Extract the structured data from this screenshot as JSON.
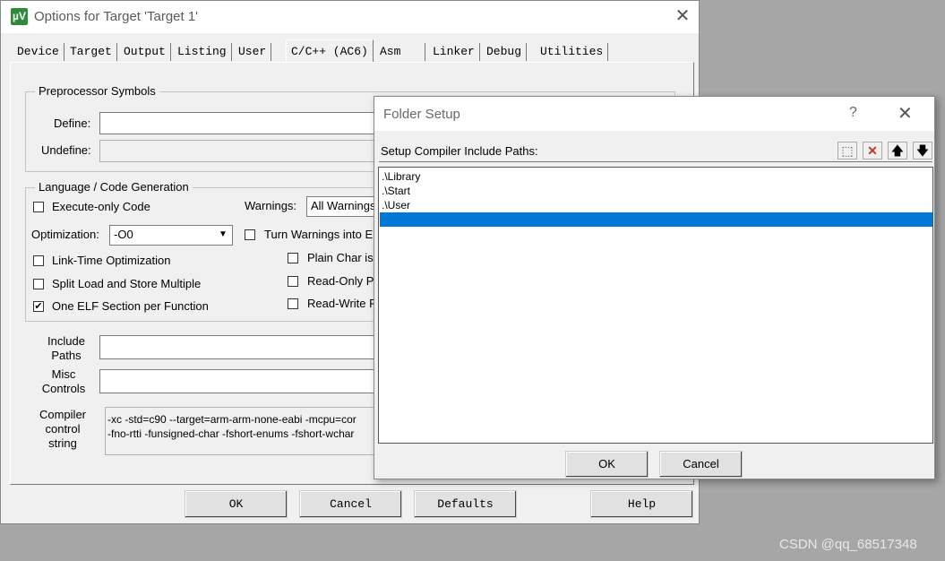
{
  "options_dialog": {
    "title": "Options for Target 'Target 1'",
    "app_icon": "µV",
    "tabs": [
      "Device",
      "Target",
      "Output",
      "Listing",
      "User",
      "C/C++ (AC6)",
      "Asm",
      "Linker",
      "Debug",
      "Utilities"
    ],
    "active_tab": "C/C++ (AC6)",
    "preprocessor": {
      "title": "Preprocessor Symbols",
      "define_label": "Define:",
      "define_value": "",
      "undefine_label": "Undefine:",
      "undefine_value": ""
    },
    "language": {
      "title": "Language / Code Generation",
      "execute_only": "Execute-only Code",
      "warnings_label": "Warnings:",
      "warnings_value": "All Warnings",
      "optimization_label": "Optimization:",
      "optimization_value": "-O0",
      "turn_warnings": "Turn Warnings into E",
      "link_time": "Link-Time Optimization",
      "plain_char": "Plain Char is",
      "split_load": "Split Load and Store Multiple",
      "read_only": "Read-Only P",
      "one_elf": "One ELF Section per Function",
      "read_write": "Read-Write F",
      "checked": "✔"
    },
    "include_paths_label": [
      "Include",
      "Paths"
    ],
    "misc_controls_label": [
      "Misc",
      "Controls"
    ],
    "compiler_string_label": [
      "Compiler",
      "control",
      "string"
    ],
    "compiler_string": [
      "-xc -std=c90 --target=arm-arm-none-eabi -mcpu=cor",
      "-fno-rtti -funsigned-char -fshort-enums -fshort-wchar"
    ],
    "buttons": {
      "ok": "OK",
      "cancel": "Cancel",
      "defaults": "Defaults",
      "help": "Help"
    },
    "close_glyph": "✕"
  },
  "folder_setup": {
    "title": "Folder Setup",
    "help_glyph": "?",
    "close_glyph": "✕",
    "header_label": "Setup Compiler Include Paths:",
    "tools": [
      {
        "icon": "new-folder-icon",
        "glyph": "⬚"
      },
      {
        "icon": "delete-icon",
        "glyph": "✕"
      },
      {
        "icon": "move-up-icon",
        "glyph": "🡅"
      },
      {
        "icon": "move-down-icon",
        "glyph": "🡇"
      }
    ],
    "paths": [
      ".\\Library",
      ".\\Start",
      ".\\User"
    ],
    "buttons": {
      "ok": "OK",
      "cancel": "Cancel"
    }
  },
  "watermark": "CSDN @qq_68517348",
  "colors": {
    "selection": "#0078d7",
    "delete_icon": "#c0392b"
  }
}
